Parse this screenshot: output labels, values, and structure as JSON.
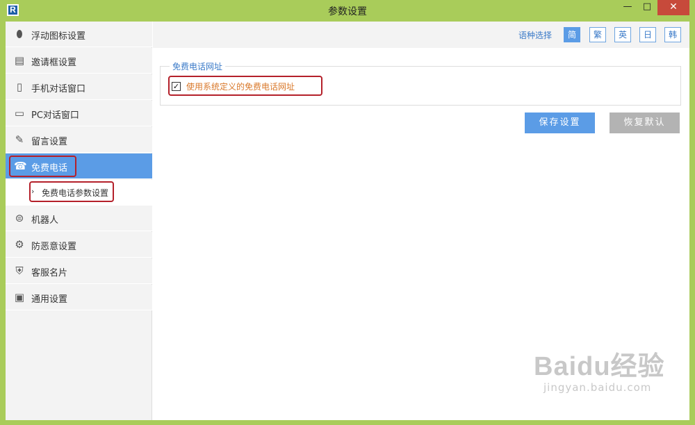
{
  "window": {
    "title": "参数设置",
    "logo_letter": "R",
    "controls": {
      "minimize": "—",
      "maximize": "□",
      "close": "✕"
    }
  },
  "sidebar": {
    "items": [
      {
        "label": "浮动图标设置",
        "icon": "pin-icon",
        "glyph": "⬮"
      },
      {
        "label": "邀请框设置",
        "icon": "document-icon",
        "glyph": "▤"
      },
      {
        "label": "手机对话窗口",
        "icon": "mobile-phone-icon",
        "glyph": "▯"
      },
      {
        "label": "PC对话窗口",
        "icon": "monitor-icon",
        "glyph": "▭"
      },
      {
        "label": "留言设置",
        "icon": "edit-note-icon",
        "glyph": "✎"
      },
      {
        "label": "免费电话",
        "icon": "telephone-icon",
        "glyph": "☎",
        "active": true
      },
      {
        "label": "机器人",
        "icon": "robot-icon",
        "glyph": "⊜"
      },
      {
        "label": "防恶意设置",
        "icon": "gear-icon",
        "glyph": "⚙"
      },
      {
        "label": "客服名片",
        "icon": "shield-icon",
        "glyph": "⛨"
      },
      {
        "label": "通用设置",
        "icon": "id-card-icon",
        "glyph": "▣"
      }
    ],
    "sub_item": {
      "label": "免费电话参数设置",
      "chevron": "›"
    }
  },
  "language": {
    "label": "语种选择",
    "options": [
      {
        "label": "简",
        "active": true
      },
      {
        "label": "繁"
      },
      {
        "label": "英"
      },
      {
        "label": "日"
      },
      {
        "label": "韩"
      }
    ]
  },
  "settings": {
    "group_title": "免费电话网址",
    "checkbox_label": "使用系统定义的免费电话网址",
    "checkbox_checked": true,
    "checkbox_mark": "✓"
  },
  "actions": {
    "save": "保存设置",
    "reset": "恢复默认"
  },
  "watermark": {
    "logo": "Baidu经验",
    "url": "jingyan.baidu.com"
  },
  "colors": {
    "accent": "#5b9ce6",
    "highlight": "#b4202a",
    "frame": "#a9cc5a",
    "option_text": "#d9782a"
  }
}
